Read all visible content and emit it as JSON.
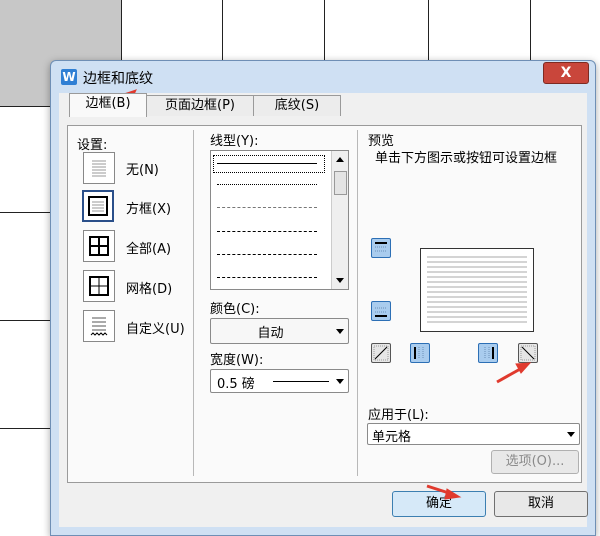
{
  "dialog": {
    "title": "边框和底纹",
    "close_label": "X",
    "app_icon_letter": "W"
  },
  "tabs": [
    {
      "label": "边框(B)"
    },
    {
      "label": "页面边框(P)"
    },
    {
      "label": "底纹(S)"
    }
  ],
  "settings": {
    "header": "设置:",
    "options": [
      {
        "label": "无(N)"
      },
      {
        "label": "方框(X)"
      },
      {
        "label": "全部(A)"
      },
      {
        "label": "网格(D)"
      },
      {
        "label": "自定义(U)"
      }
    ]
  },
  "line_style": {
    "header": "线型(Y):",
    "styles": [
      "solid",
      "dotted",
      "dashed-fine",
      "dashed",
      "dash-dot",
      "dash-dot-dot"
    ]
  },
  "color": {
    "header": "颜色(C):",
    "value": "自动"
  },
  "width": {
    "header": "宽度(W):",
    "value": "0.5  磅"
  },
  "preview": {
    "header": "预览",
    "hint": "单击下方图示或按钮可设置边框"
  },
  "apply_to": {
    "header": "应用于(L):",
    "value": "单元格"
  },
  "buttons": {
    "options": "选项(O)...",
    "ok": "确定",
    "cancel": "取消"
  },
  "colors": {
    "annotation_arrow": "#e03a2e",
    "dialog_frame": "#cfe0f3"
  }
}
